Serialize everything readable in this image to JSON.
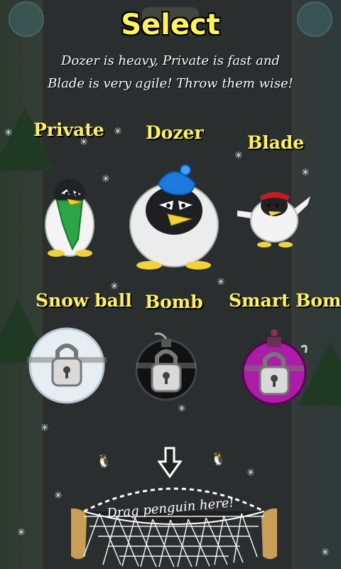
{
  "screen": {
    "title": "Select",
    "subtitle_line1": "Dozer is heavy, Private is fast and",
    "subtitle_line2": "Blade is very agile! Throw them wise!"
  },
  "penguins": [
    {
      "name": "Private",
      "icon": "private-penguin-icon",
      "accent": "#22a34a"
    },
    {
      "name": "Dozer",
      "icon": "dozer-penguin-icon",
      "accent": "#1e7bd8"
    },
    {
      "name": "Blade",
      "icon": "blade-penguin-icon",
      "accent": "#c8202b"
    }
  ],
  "weapons": [
    {
      "name": "Snow ball",
      "icon": "snowball-lock-icon",
      "locked": true
    },
    {
      "name": "Bomb",
      "icon": "bomb-lock-icon",
      "locked": true
    },
    {
      "name": "Smart Bomb",
      "icon": "smart-bomb-lock-icon",
      "locked": true
    }
  ],
  "bottom": {
    "drag_label": "Drag penguin here!"
  },
  "colors": {
    "title": "#fff35a",
    "label": "#fff15a",
    "background": "#2f3432"
  }
}
